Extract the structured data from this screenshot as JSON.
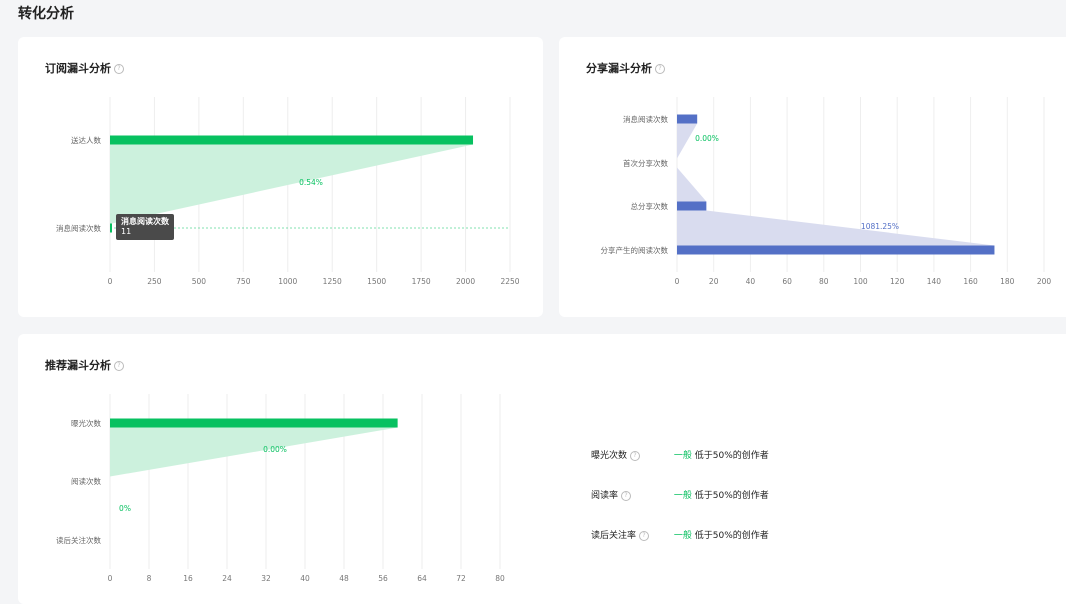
{
  "page": {
    "title": "转化分析"
  },
  "colors": {
    "green": "#07c160",
    "green_fill": "#c9f0db",
    "blue": "#5470c6",
    "blue_fill": "#d7daee"
  },
  "subscribe_funnel": {
    "title": "订阅漏斗分析",
    "tooltip": {
      "title": "消息阅读次数",
      "value": "11"
    }
  },
  "share_funnel": {
    "title": "分享漏斗分析"
  },
  "recommend_funnel": {
    "title": "推荐漏斗分析"
  },
  "metrics": [
    {
      "label": "曝光次数",
      "level": "一般",
      "desc": "低于50%的创作者"
    },
    {
      "label": "阅读率",
      "level": "一般",
      "desc": "低于50%的创作者"
    },
    {
      "label": "读后关注率",
      "level": "一般",
      "desc": "低于50%的创作者"
    }
  ],
  "chart_data": [
    {
      "type": "bar",
      "title": "订阅漏斗分析",
      "categories": [
        "送达人数",
        "消息阅读次数"
      ],
      "values": [
        2042,
        11
      ],
      "conversion_labels": [
        "0.54%"
      ],
      "xlim": [
        0,
        2250
      ],
      "xticks": [
        0,
        250,
        500,
        750,
        1000,
        1250,
        1500,
        1750,
        2000,
        2250
      ],
      "color": "#07c160"
    },
    {
      "type": "bar",
      "title": "分享漏斗分析",
      "categories": [
        "消息阅读次数",
        "首次分享次数",
        "总分享次数",
        "分享产生的阅读次数"
      ],
      "values": [
        11,
        0,
        16,
        173
      ],
      "conversion_labels": [
        "0.00%",
        "1081.25%"
      ],
      "xlim": [
        0,
        200
      ],
      "xticks": [
        0,
        20,
        40,
        60,
        80,
        100,
        120,
        140,
        160,
        180,
        200
      ],
      "color": "#5470c6"
    },
    {
      "type": "bar",
      "title": "推荐漏斗分析",
      "categories": [
        "曝光次数",
        "阅读次数",
        "读后关注次数"
      ],
      "values": [
        59,
        0,
        0
      ],
      "conversion_labels": [
        "0.00%",
        "0%"
      ],
      "xlim": [
        0,
        80
      ],
      "xticks": [
        0,
        8,
        16,
        24,
        32,
        40,
        48,
        56,
        64,
        72,
        80
      ],
      "color": "#07c160"
    }
  ]
}
